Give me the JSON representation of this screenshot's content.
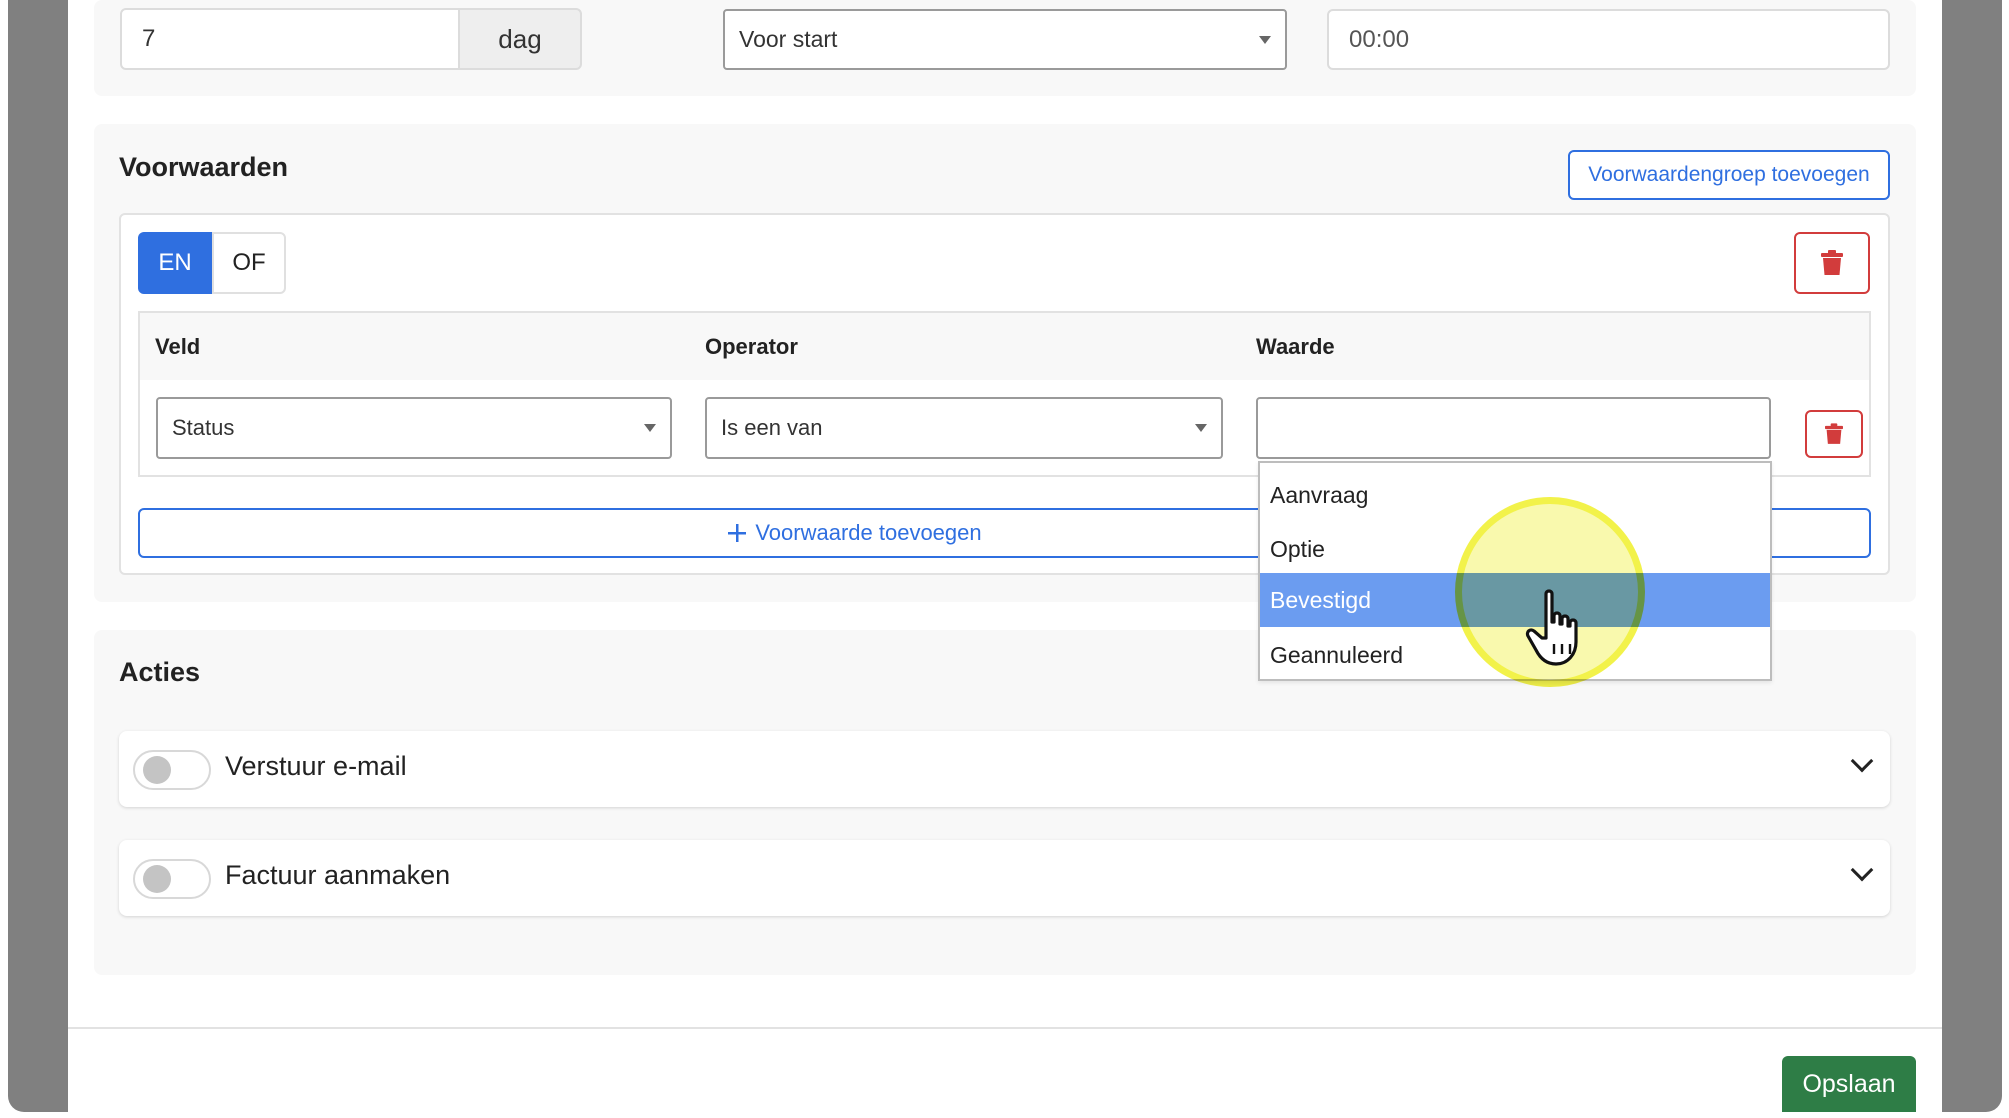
{
  "reminder": {
    "amount_value": "7",
    "unit_label": "dag",
    "timing_select_value": "Voor start",
    "time_value": "00:00"
  },
  "conditions": {
    "title": "Voorwaarden",
    "add_group_label": "Voorwaardengroep toevoegen",
    "logic_and_label": "EN",
    "logic_or_label": "OF",
    "columns": {
      "field": "Veld",
      "operator": "Operator",
      "value": "Waarde"
    },
    "row": {
      "field_value": "Status",
      "operator_value": "Is een van",
      "value_value": ""
    },
    "add_condition_label": "Voorwaarde toevoegen",
    "dropdown_options": [
      "Aanvraag",
      "Optie",
      "Bevestigd",
      "Geannuleerd"
    ],
    "highlighted_option": "Bevestigd"
  },
  "actions": {
    "title": "Acties",
    "items": [
      {
        "label": "Verstuur e-mail",
        "enabled": false
      },
      {
        "label": "Factuur aanmaken",
        "enabled": false
      }
    ]
  },
  "footer": {
    "save_label": "Opslaan"
  },
  "colors": {
    "primary": "#2f6fe0",
    "danger": "#d23c3c",
    "success": "#2e7d46",
    "highlight": "#6b9cf0",
    "cursor_ring": "#f2f24a"
  },
  "icons": {
    "trash": "trash-icon",
    "plus": "plus-icon",
    "chevron": "chevron-down-icon",
    "cursor": "hand-cursor-icon"
  }
}
